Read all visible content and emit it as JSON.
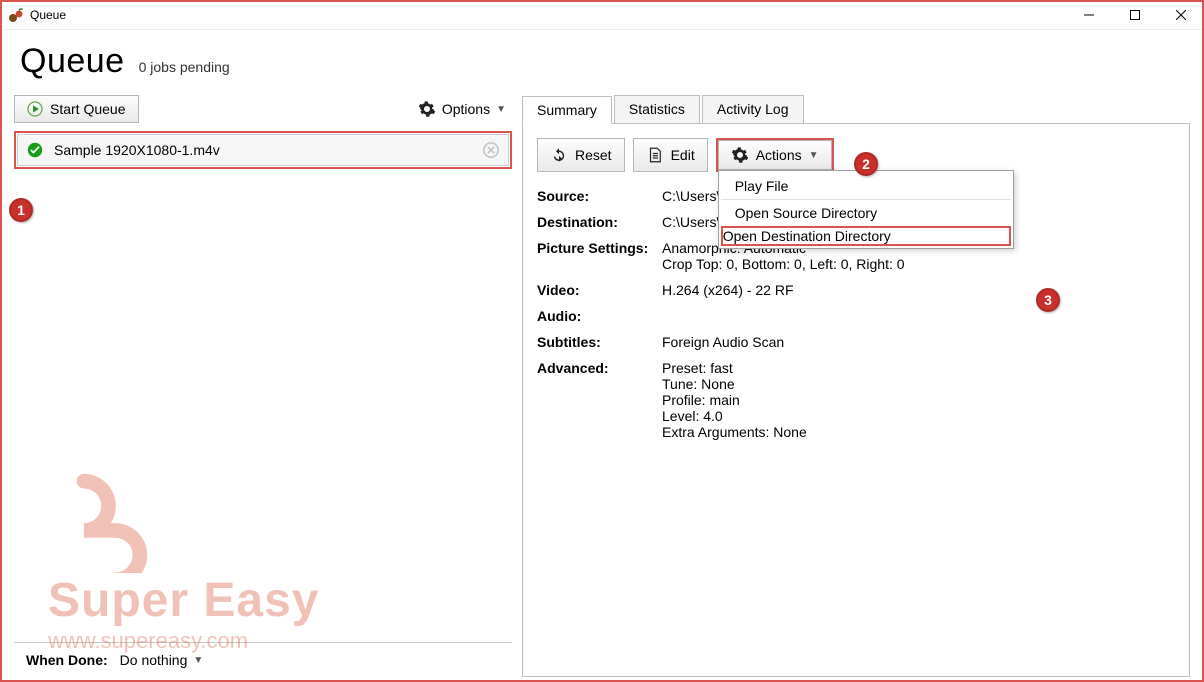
{
  "window": {
    "title": "Queue"
  },
  "header": {
    "title": "Queue",
    "subtitle": "0 jobs pending"
  },
  "left": {
    "start_label": "Start Queue",
    "options_label": "Options",
    "item_name": "Sample 1920X1080-1.m4v",
    "when_done_label": "When Done:",
    "when_done_value": "Do nothing"
  },
  "tabs": {
    "summary": "Summary",
    "statistics": "Statistics",
    "activity": "Activity Log"
  },
  "panel_buttons": {
    "reset": "Reset",
    "edit": "Edit",
    "actions": "Actions"
  },
  "actions_menu": {
    "play": "Play File",
    "open_source": "Open Source Directory",
    "open_dest": "Open Destination Directory"
  },
  "summary": {
    "source_label": "Source:",
    "source_value": "C:\\Users\\M                                              1920x1080.wmv",
    "destination_label": "Destination:",
    "destination_value": "C:\\Users\\M                                              X1080-1.m4v",
    "picture_label": "Picture Settings:",
    "picture_line1": "Anamorphic: Automatic",
    "picture_line2": "Crop Top: 0, Bottom: 0, Left: 0, Right: 0",
    "video_label": "Video:",
    "video_value": "H.264 (x264) - 22 RF",
    "audio_label": "Audio:",
    "audio_value": "",
    "subtitles_label": "Subtitles:",
    "subtitles_value": "Foreign Audio Scan",
    "advanced_label": "Advanced:",
    "advanced_lines": "Preset: fast\nTune: None\nProfile: main\nLevel: 4.0\nExtra Arguments: None"
  },
  "watermark": {
    "title": "Super Easy",
    "url": "www.supereasy.com"
  },
  "badges": {
    "b1": "1",
    "b2": "2",
    "b3": "3"
  }
}
